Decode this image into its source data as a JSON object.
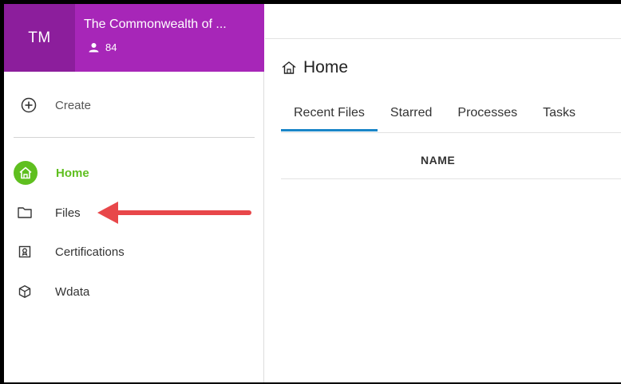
{
  "org": {
    "initials": "TM",
    "name": "The Commonwealth of ...",
    "member_count": "84",
    "header_color": "#a726b8"
  },
  "sidebar": {
    "create_label": "Create",
    "items": [
      {
        "label": "Home",
        "icon": "home-icon",
        "active": true
      },
      {
        "label": "Files",
        "icon": "folder-icon",
        "active": false
      },
      {
        "label": "Certifications",
        "icon": "certificate-icon",
        "active": false
      },
      {
        "label": "Wdata",
        "icon": "cube-icon",
        "active": false
      }
    ],
    "active_color": "#5fbf1f"
  },
  "main": {
    "title": "Home",
    "tabs": [
      {
        "label": "Recent Files",
        "active": true
      },
      {
        "label": "Starred",
        "active": false
      },
      {
        "label": "Processes",
        "active": false
      },
      {
        "label": "Tasks",
        "active": false
      }
    ],
    "table": {
      "columns": [
        "NAME"
      ]
    },
    "accent_color": "#1a86c8"
  },
  "annotation": {
    "arrow_color": "#e8474a"
  }
}
